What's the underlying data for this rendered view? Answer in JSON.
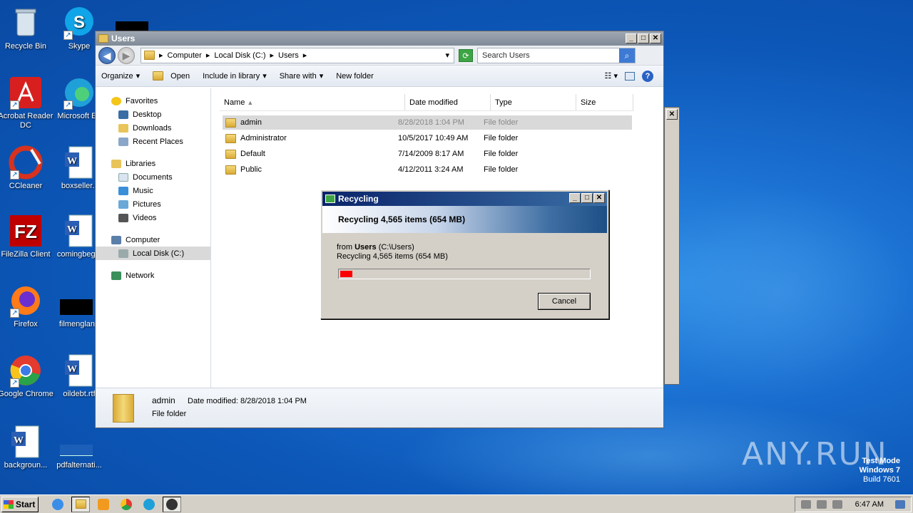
{
  "desktop_icons": [
    {
      "label": "Recycle Bin"
    },
    {
      "label": "Skype"
    },
    {
      "label": "Acrobat Reader DC"
    },
    {
      "label": "Microsoft Ed"
    },
    {
      "label": "CCleaner"
    },
    {
      "label": "boxseller.r"
    },
    {
      "label": "FileZilla Client"
    },
    {
      "label": "comingbegin"
    },
    {
      "label": "Firefox"
    },
    {
      "label": "filmengland"
    },
    {
      "label": "Google Chrome"
    },
    {
      "label": "oildebt.rtf"
    },
    {
      "label": "backgroun..."
    },
    {
      "label": "pdfalternati..."
    }
  ],
  "explorer": {
    "title": "Users",
    "breadcrumb": [
      "Computer",
      "Local Disk (C:)",
      "Users"
    ],
    "search_placeholder": "Search Users",
    "toolbar": {
      "organize": "Organize",
      "open": "Open",
      "include": "Include in library",
      "share": "Share with",
      "new_folder": "New folder"
    },
    "nav": {
      "favorites": "Favorites",
      "desktop": "Desktop",
      "downloads": "Downloads",
      "recent": "Recent Places",
      "libraries": "Libraries",
      "documents": "Documents",
      "music": "Music",
      "pictures": "Pictures",
      "videos": "Videos",
      "computer": "Computer",
      "local_disk": "Local Disk (C:)",
      "network": "Network"
    },
    "columns": {
      "name": "Name",
      "date": "Date modified",
      "type": "Type",
      "size": "Size"
    },
    "rows": [
      {
        "name": "admin",
        "date": "8/28/2018 1:04 PM",
        "type": "File folder"
      },
      {
        "name": "Administrator",
        "date": "10/5/2017 10:49 AM",
        "type": "File folder"
      },
      {
        "name": "Default",
        "date": "7/14/2009 8:17 AM",
        "type": "File folder"
      },
      {
        "name": "Public",
        "date": "4/12/2011 3:24 AM",
        "type": "File folder"
      }
    ],
    "details": {
      "name": "admin",
      "date_label": "Date modified:",
      "date": "8/28/2018 1:04 PM",
      "type": "File folder"
    }
  },
  "dialog": {
    "title": "Recycling",
    "heading": "Recycling 4,565 items (654 MB)",
    "from_prefix": "from",
    "from_bold": "Users",
    "from_path": "(C:\\Users)",
    "status": "Recycling 4,565 items (654 MB)",
    "progress": 0.05,
    "cancel": "Cancel"
  },
  "taskbar": {
    "start": "Start",
    "clock": "6:47 AM"
  },
  "watermark": {
    "line1": "Test Mode",
    "line2": "Windows 7",
    "line3": "Build 7601",
    "brand": "ANY.RUN"
  }
}
